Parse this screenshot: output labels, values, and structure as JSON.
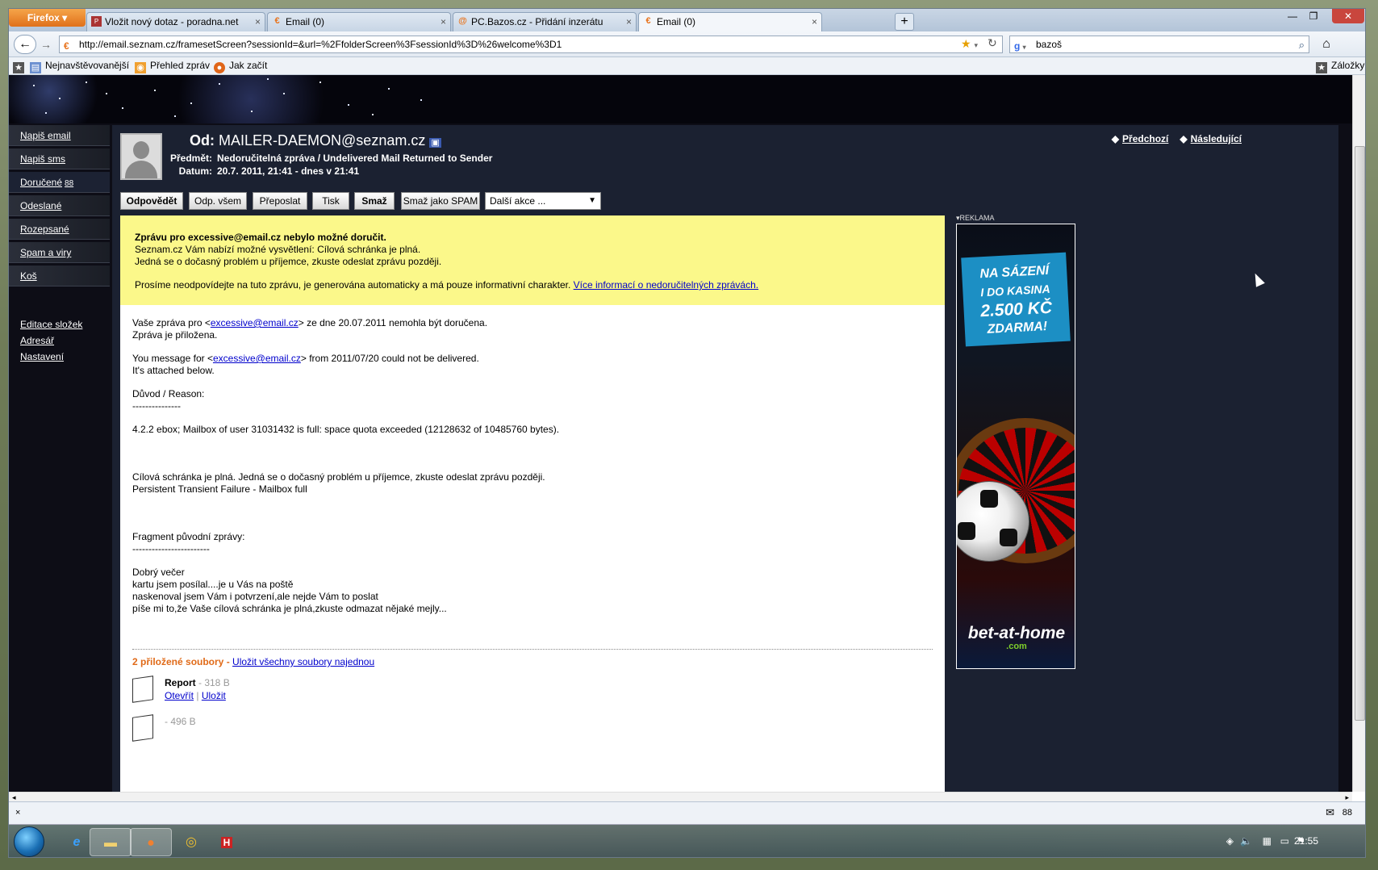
{
  "browser": {
    "menu_button": "Firefox",
    "tabs": [
      {
        "label": "Vložit nový dotaz - poradna.net",
        "icon": "poradna-favicon",
        "active": false
      },
      {
        "label": "Email (0)",
        "icon": "seznam-favicon",
        "active": false
      },
      {
        "label": "PC.Bazos.cz - Přidání inzerátu",
        "icon": "bazos-favicon",
        "active": false
      },
      {
        "label": "Email (0)",
        "icon": "seznam-favicon",
        "active": true
      }
    ],
    "new_tab": "+",
    "url": "http://email.seznam.cz/framesetScreen?sessionId=&url=%2FfolderScreen%3FsessionId%3D%26welcome%3D1",
    "search_value": "bazoš",
    "bookmarks": [
      "Nejnavštěvovanější",
      "Přehled zpráv",
      "Jak začít"
    ],
    "bookmarks_menu": "Záložky"
  },
  "sidebar": {
    "items": [
      {
        "label": "Napiš email"
      },
      {
        "label": "Napiš sms"
      },
      {
        "label": "Doručené",
        "count": "88"
      },
      {
        "label": "Odeslané"
      },
      {
        "label": "Rozepsané"
      },
      {
        "label": "Spam a viry"
      },
      {
        "label": "Koš"
      }
    ],
    "links": [
      "Editace složek",
      "Adresář",
      "Nastavení"
    ]
  },
  "message": {
    "from_label": "Od:",
    "from": "MAILER-DAEMON@seznam.cz",
    "subject_label": "Předmět:",
    "subject": "Nedoručitelná zpráva / Undelivered Mail Returned to Sender",
    "date_label": "Datum:",
    "date": "20.7. 2011, 21:41 - dnes v 21:41",
    "prev": "Předchozí",
    "next": "Následující"
  },
  "toolbar": {
    "reply": "Odpovědět",
    "reply_all": "Odp. všem",
    "forward": "Přeposlat",
    "print": "Tisk",
    "delete": "Smaž",
    "delete_spam": "Smaž jako SPAM",
    "more_actions": "Další akce ..."
  },
  "notice": {
    "title": "Zprávu pro excessive@email.cz nebylo možné doručit.",
    "line1": "Seznam.cz Vám nabízí možné vysvětlení: Cílová schránka je plná.",
    "line2": "Jedná se o dočasný problém u příjemce, zkuste odeslat zprávu později.",
    "line3": "Prosíme neodpovídejte na tuto zprávu, je generována automaticky a má pouze informativní charakter.",
    "link": "Více informací o nedoručitelných zprávách."
  },
  "body": {
    "l1a": "Vaše zpráva pro <",
    "email": "excessive@email.cz",
    "l1b": "> ze dne 20.07.2011 nemohla být doručena.",
    "l2": "Zpráva je přiložena.",
    "l3a": "You message for <",
    "l3b": "> from 2011/07/20 could not be delivered.",
    "l4": "It's attached below.",
    "l5": "Důvod / Reason:",
    "l6": "---------------",
    "l7": "4.2.2 ebox; Mailbox of user 31031432 is full: space quota exceeded (12128632 of 10485760 bytes).",
    "l8": "Cílová schránka je plná. Jedná se o dočasný problém u příjemce, zkuste odeslat zprávu později.",
    "l9": "Persistent Transient Failure - Mailbox full",
    "l10": "Fragment původní zprávy:",
    "l11": "------------------------",
    "l12": "Dobrý večer",
    "l13": "kartu jsem posílal....je u Vás na poště",
    "l14": "naskenoval jsem Vám i potvrzení,ale nejde Vám to poslat",
    "l15": "píše mi to,že Vaše cílová schránka je plná,zkuste odmazat nějaké mejly..."
  },
  "attachments": {
    "title": "2 přiložené soubory",
    "sep": " - ",
    "save_all": "Uložit všechny soubory najednou",
    "files": [
      {
        "name": "Report",
        "size": " - 318 B",
        "open": "Otevřít",
        "save": "Uložit"
      },
      {
        "name": "",
        "size": "- 496 B"
      }
    ]
  },
  "ad": {
    "label": "REKLAMA",
    "line1": "NA SÁZENÍ",
    "line2": "I DO KASINA",
    "amount": "2.500 KČ",
    "line3": "ZDARMA!",
    "brand": "bet-at-home",
    "brand_sub": ".com"
  },
  "status": {
    "close": "×",
    "mail_count": "88"
  },
  "taskbar": {
    "clock": "21:55"
  },
  "colors": {
    "page_bg": "#0d0d16",
    "notice_bg": "#fbf88a",
    "attachment_title": "#e06a18",
    "link": "#0000cc"
  }
}
